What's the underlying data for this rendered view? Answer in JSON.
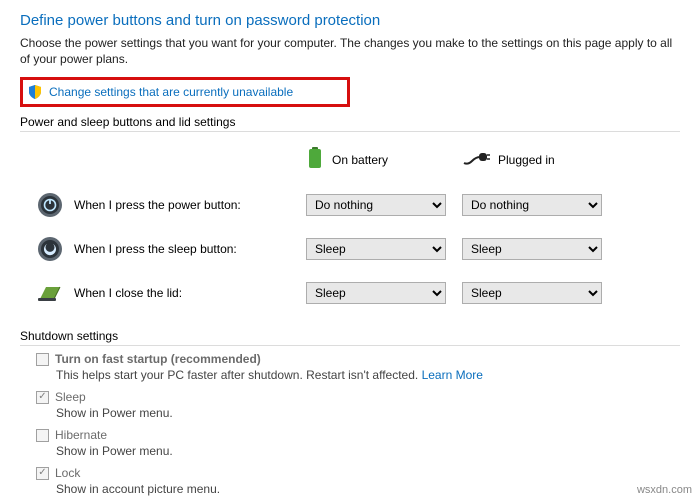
{
  "title": "Define power buttons and turn on password protection",
  "description": "Choose the power settings that you want for your computer. The changes you make to the settings on this page apply to all of your power plans.",
  "change_link": "Change settings that are currently unavailable",
  "section_buttons": "Power and sleep buttons and lid settings",
  "columns": {
    "battery": "On battery",
    "plugged": "Plugged in"
  },
  "rows": {
    "power": {
      "label": "When I press the power button:",
      "battery": "Do nothing",
      "plugged": "Do nothing"
    },
    "sleep": {
      "label": "When I press the sleep button:",
      "battery": "Sleep",
      "plugged": "Sleep"
    },
    "lid": {
      "label": "When I close the lid:",
      "battery": "Sleep",
      "plugged": "Sleep"
    }
  },
  "section_shutdown": "Shutdown settings",
  "shutdown": {
    "fast": {
      "label": "Turn on fast startup (recommended)",
      "sub_before": "This helps start your PC faster after shutdown. Restart isn't affected. ",
      "learn": "Learn More",
      "checked": false
    },
    "sleep": {
      "label": "Sleep",
      "sub": "Show in Power menu.",
      "checked": true
    },
    "hibernate": {
      "label": "Hibernate",
      "sub": "Show in Power menu.",
      "checked": false
    },
    "lock": {
      "label": "Lock",
      "sub": "Show in account picture menu.",
      "checked": true
    }
  },
  "watermark": "wsxdn.com"
}
